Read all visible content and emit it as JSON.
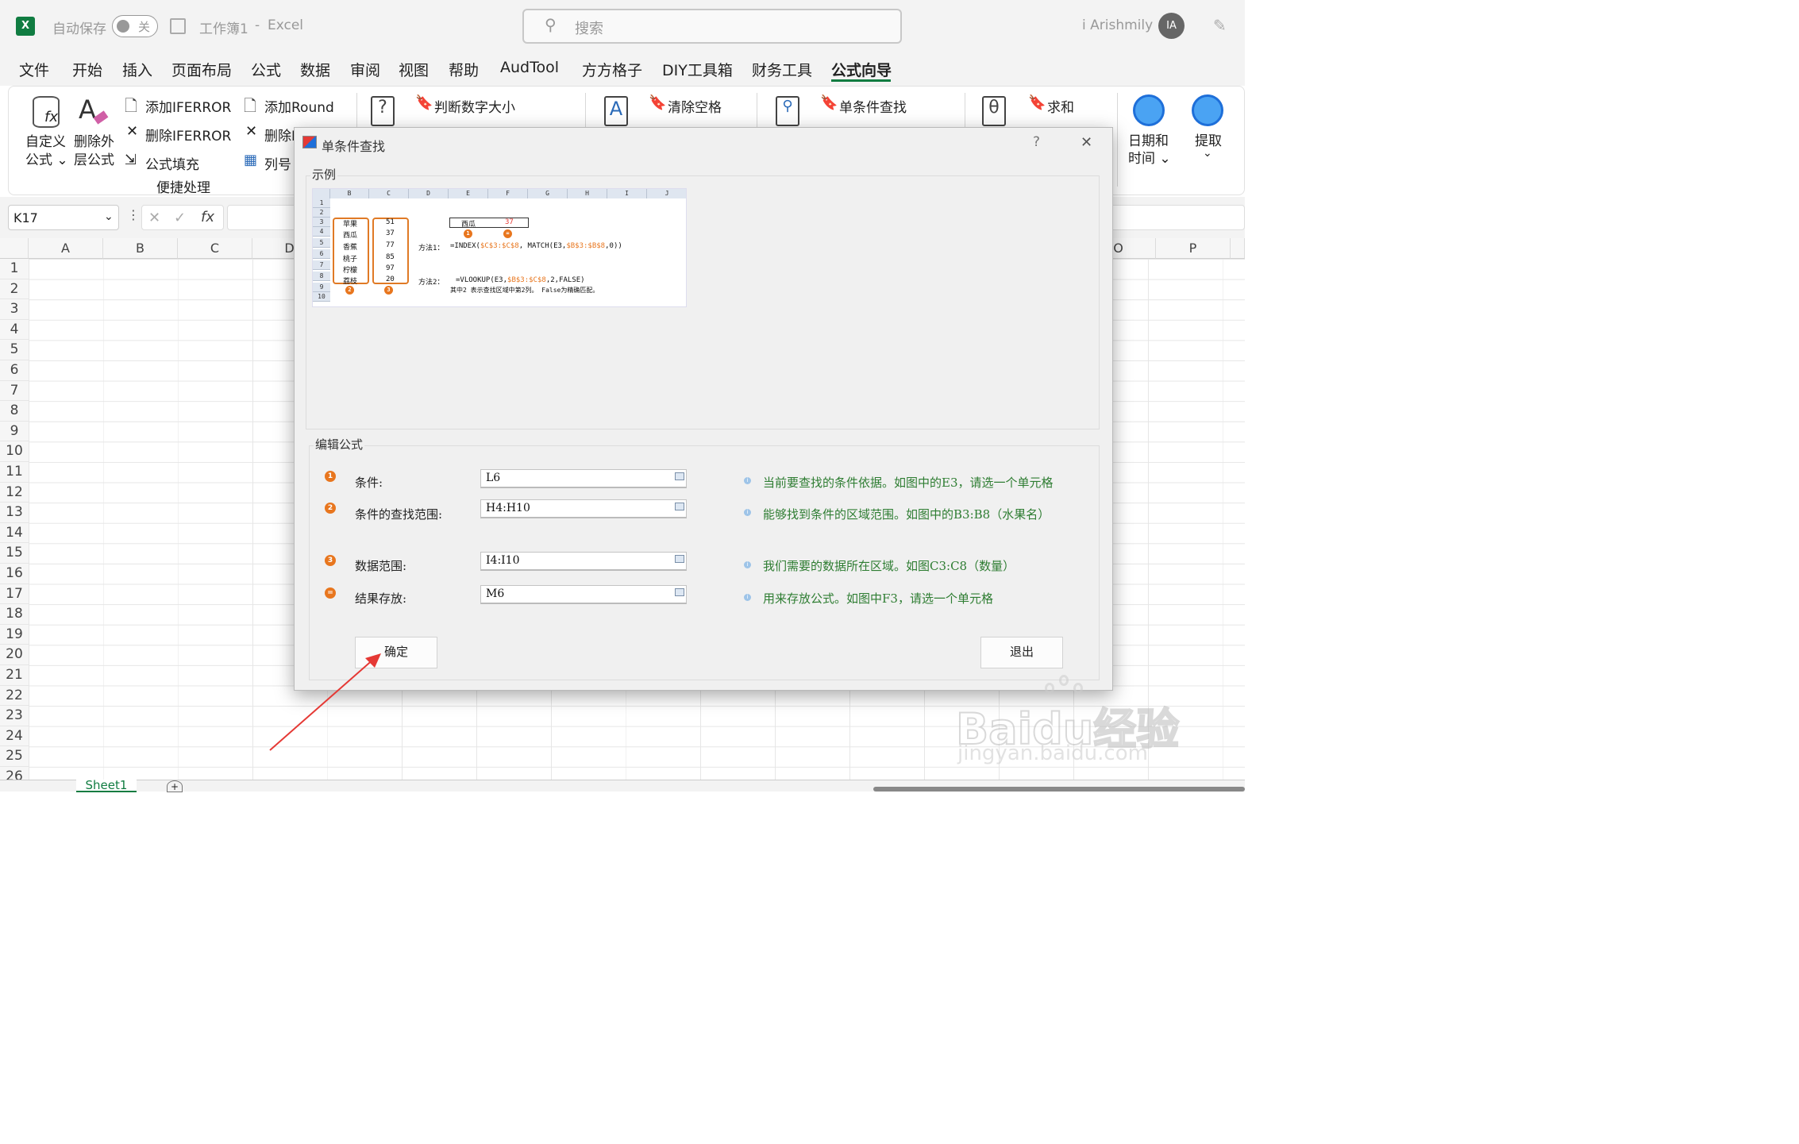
{
  "app": {
    "autosave_label": "自动保存",
    "autosave_state": "关",
    "workbook_title": "工作簿1",
    "title_sep": "-",
    "app_name": "Excel",
    "search_placeholder": "搜索",
    "user_name": "i Arishmily",
    "user_initials": "IA"
  },
  "tabs": [
    "文件",
    "开始",
    "插入",
    "页面布局",
    "公式",
    "数据",
    "审阅",
    "视图",
    "帮助",
    "AudTool",
    "方方格子",
    "DIY工具箱",
    "财务工具",
    "公式向导"
  ],
  "active_tab": "公式向导",
  "ribbon": {
    "custom_formula": [
      "自定义",
      "公式 ⌄"
    ],
    "remove_outer": [
      "删除外",
      "层公式"
    ],
    "add_iferror": "添加IFERROR",
    "del_iferror": "删除IFERROR",
    "formula_fill": "公式填充",
    "add_round": "添加Round",
    "del_round": "删除R",
    "col_num": "列号",
    "group_quick": "便捷处理",
    "judge_size": "判断数字大小",
    "clear_space": "清除空格",
    "single_lookup": "单条件查找",
    "sum": "求和",
    "date_time": [
      "日期和",
      "时间 ⌄"
    ],
    "extract": "提取",
    "extract_caret": "⌄"
  },
  "formula_bar": {
    "name_box": "K17",
    "fx": "fx",
    "cancel": "✕",
    "enter": "✓"
  },
  "grid": {
    "left_cols": [
      "A",
      "B",
      "C",
      "D"
    ],
    "right_cols": [
      "O",
      "P"
    ],
    "rows": [
      "1",
      "2",
      "3",
      "4",
      "5",
      "6",
      "7",
      "8",
      "9",
      "10",
      "11",
      "12",
      "13",
      "14",
      "15",
      "16",
      "17",
      "18",
      "19",
      "20",
      "21",
      "22",
      "23",
      "24",
      "25",
      "26"
    ]
  },
  "sheet_tabs": {
    "active": "Sheet1",
    "add": "+"
  },
  "dialog": {
    "title": "单条件查找",
    "help": "?",
    "close": "✕",
    "example_group": "示例",
    "edit_group": "编辑公式",
    "fields": [
      {
        "num": "1",
        "label": "条件:",
        "value": "L6",
        "hint": "当前要查找的条件依据。如图中的E3，请选一个单元格"
      },
      {
        "num": "2",
        "label": "条件的查找范围:",
        "value": "H4:H10",
        "hint": "能够找到条件的区域范围。如图中的B3:B8（水果名）"
      },
      {
        "num": "3",
        "label": "数据范围:",
        "value": "I4:I10",
        "hint": "我们需要的数据所在区域。如图C3:C8（数量）"
      },
      {
        "num": "=",
        "label": "结果存放:",
        "value": "M6",
        "hint": "用来存放公式。如图中F3，请选一个单元格"
      }
    ],
    "ok": "确定",
    "exit": "退出"
  },
  "example": {
    "cols": [
      "B",
      "C",
      "D",
      "E",
      "F",
      "G",
      "H",
      "I",
      "J"
    ],
    "rows": [
      "1",
      "2",
      "3",
      "4",
      "5",
      "6",
      "7",
      "8",
      "9",
      "10"
    ],
    "fruits": [
      "苹果",
      "西瓜",
      "香蕉",
      "桃子",
      "柠檬",
      "荔枝"
    ],
    "qty": [
      "51",
      "37",
      "77",
      "85",
      "97",
      "20"
    ],
    "e3": "西瓜",
    "f3": "37",
    "method1_label": "方法1：",
    "method1_pre": "=INDEX(",
    "method1_hl1": "$C$3:$C$8",
    "method1_mid": ", MATCH(E3,",
    "method1_hl2": "$B$3:$B$8",
    "method1_post": ",0))",
    "method2_label": "方法2：",
    "method2_pre": "=VLOOKUP(E3,",
    "method2_hl": "$B$3:$C$8",
    "method2_post": ",2,FALSE)",
    "note": "其中2 表示查找区域中第2列。 False为精确匹配。",
    "badges": [
      "1",
      "=",
      "2",
      "3"
    ]
  },
  "watermark": {
    "brand": "Baidu经验",
    "url": "jingyan.baidu.com"
  },
  "colors": {
    "excel_green": "#107c41",
    "accent": "#e8761e",
    "hint": "#2e7d32",
    "arrow": "#e53935"
  }
}
